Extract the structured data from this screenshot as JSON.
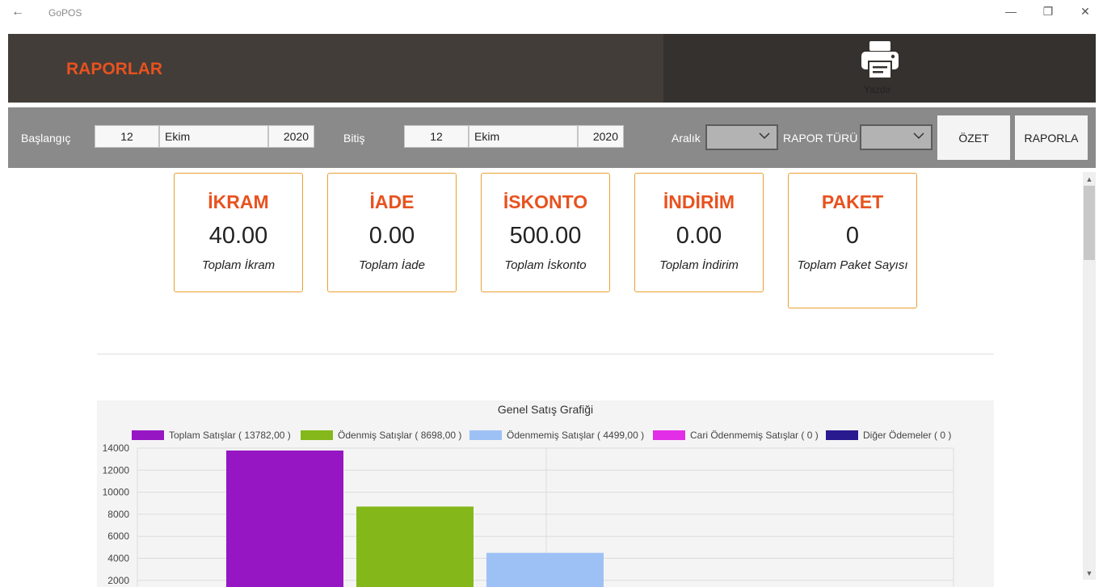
{
  "window": {
    "title": "GoPOS",
    "back_icon": "arrow-left-icon",
    "controls": [
      "minimize-icon",
      "restore-icon",
      "close-icon"
    ]
  },
  "header": {
    "title": "RAPORLAR",
    "print_label": "Yazdır",
    "print_icon": "printer-icon"
  },
  "filters": {
    "start_label": "Başlangıç",
    "start": {
      "day": "12",
      "month": "Ekim",
      "year": "2020"
    },
    "end_label": "Bitiş",
    "end": {
      "day": "12",
      "month": "Ekim",
      "year": "2020"
    },
    "range_label": "Aralık",
    "range_value": "",
    "report_type_label": "RAPOR TÜRÜ",
    "report_type_value": "",
    "summary_button": "ÖZET",
    "report_button": "RAPORLA"
  },
  "cards": [
    {
      "title": "İKRAM",
      "value": "40.00",
      "subtitle": "Toplam İkram"
    },
    {
      "title": "İADE",
      "value": "0.00",
      "subtitle": "Toplam İade"
    },
    {
      "title": "İSKONTO",
      "value": "500.00",
      "subtitle": "Toplam İskonto"
    },
    {
      "title": "İNDİRİM",
      "value": "0.00",
      "subtitle": "Toplam İndirim"
    },
    {
      "title": "PAKET",
      "value": "0",
      "subtitle": "Toplam Paket Sayısı"
    }
  ],
  "colors": {
    "accent": "#e8521f",
    "card_border": "#e8a030",
    "header_dark": "#423d38",
    "filter_bar": "#8a8a8a"
  },
  "chart_data": {
    "type": "bar",
    "title": "Genel Satış Grafiği",
    "legend_position": "top",
    "grid": true,
    "ylim": [
      0,
      14000
    ],
    "yticks": [
      2000,
      4000,
      6000,
      8000,
      10000,
      12000,
      14000
    ],
    "series": [
      {
        "name": "Toplam Satışlar ( 13782,00 )",
        "value": 13782,
        "color": "#9616c4"
      },
      {
        "name": "Ödenmiş Satışlar ( 8698,00 )",
        "value": 8698,
        "color": "#84b81a"
      },
      {
        "name": "Ödenmemiş Satışlar ( 4499,00 )",
        "value": 4499,
        "color": "#9ec1f5"
      },
      {
        "name": "Cari Ödenmemiş Satışlar ( 0 )",
        "value": 0,
        "color": "#e32ee8"
      },
      {
        "name": "Diğer Ödemeler ( 0 )",
        "value": 0,
        "color": "#2a1a90"
      }
    ]
  }
}
